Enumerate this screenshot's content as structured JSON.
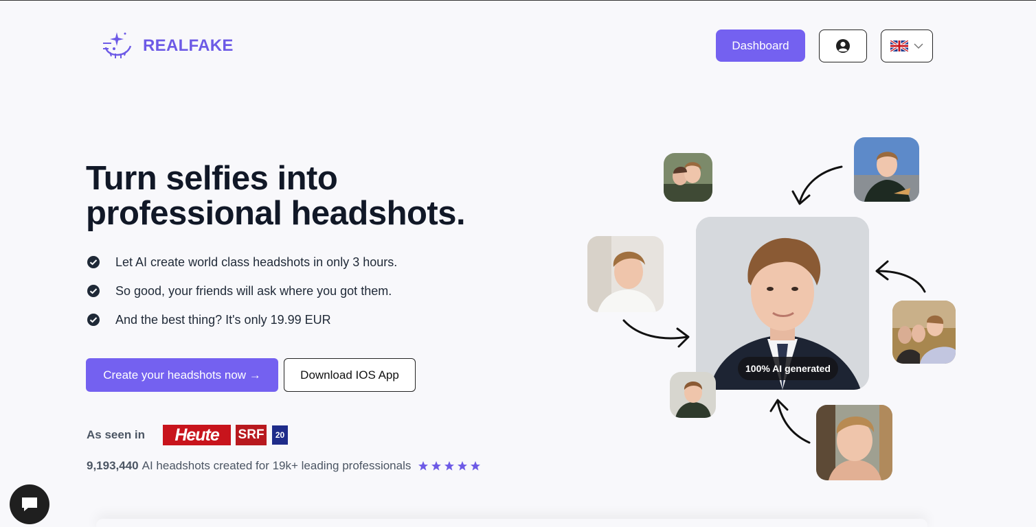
{
  "header": {
    "brand": "REALFAKE",
    "dashboard_label": "Dashboard",
    "account_icon": "user-circle-icon",
    "language_icon": "uk-flag-icon"
  },
  "hero": {
    "title": "Turn selfies into professional headshots.",
    "features": [
      "Let AI create world class headshots in only 3 hours.",
      "So good, your friends will ask where you got them.",
      "And the best thing? It's only 19.99 EUR"
    ],
    "cta_primary": "Create your headshots now →",
    "cta_secondary": "Download IOS App"
  },
  "press": {
    "label": "As seen in",
    "logos": [
      "Heute",
      "SRF",
      "20"
    ]
  },
  "stats": {
    "count": "9,193,440",
    "text": "AI headshots created for 19k+ leading professionals",
    "rating": 5
  },
  "visual": {
    "badge": "100% AI generated"
  },
  "colors": {
    "accent": "#7461f0",
    "brand": "#6d5ae6"
  }
}
